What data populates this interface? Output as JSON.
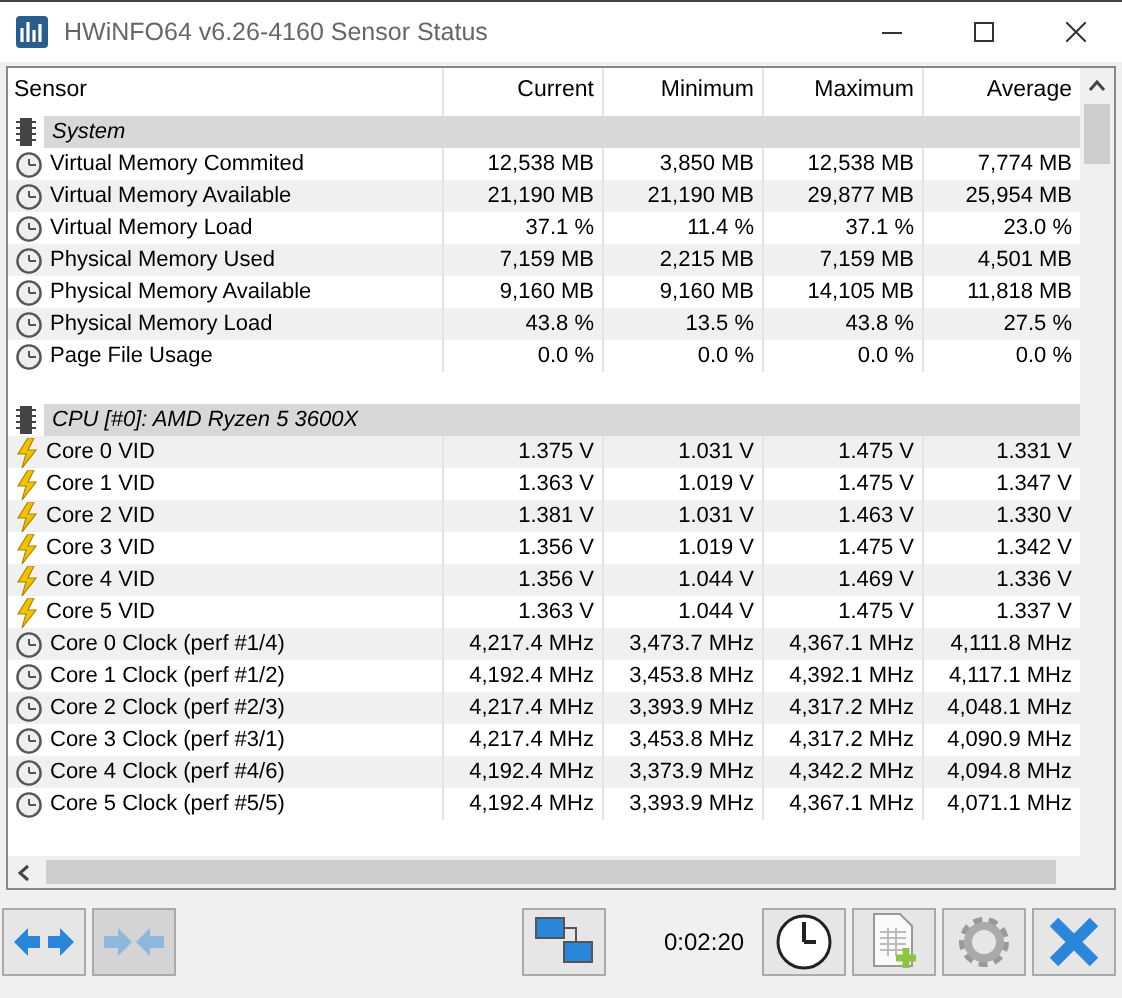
{
  "window": {
    "title": "HWiNFO64 v6.26-4160 Sensor Status"
  },
  "table": {
    "columns": [
      "Sensor",
      "Current",
      "Minimum",
      "Maximum",
      "Average"
    ],
    "rows": [
      {
        "kind": "group",
        "label": "System"
      },
      {
        "kind": "clock",
        "label": "Virtual Memory Commited",
        "values": [
          "12,538 MB",
          "3,850 MB",
          "12,538 MB",
          "7,774 MB"
        ]
      },
      {
        "kind": "clock",
        "label": "Virtual Memory Available",
        "values": [
          "21,190 MB",
          "21,190 MB",
          "29,877 MB",
          "25,954 MB"
        ]
      },
      {
        "kind": "clock",
        "label": "Virtual Memory Load",
        "values": [
          "37.1 %",
          "11.4 %",
          "37.1 %",
          "23.0 %"
        ]
      },
      {
        "kind": "clock",
        "label": "Physical Memory Used",
        "values": [
          "7,159 MB",
          "2,215 MB",
          "7,159 MB",
          "4,501 MB"
        ]
      },
      {
        "kind": "clock",
        "label": "Physical Memory Available",
        "values": [
          "9,160 MB",
          "9,160 MB",
          "14,105 MB",
          "11,818 MB"
        ]
      },
      {
        "kind": "clock",
        "label": "Physical Memory Load",
        "values": [
          "43.8 %",
          "13.5 %",
          "43.8 %",
          "27.5 %"
        ]
      },
      {
        "kind": "clock",
        "label": "Page File Usage",
        "values": [
          "0.0 %",
          "0.0 %",
          "0.0 %",
          "0.0 %"
        ]
      },
      {
        "kind": "blank"
      },
      {
        "kind": "group",
        "label": "CPU [#0]: AMD Ryzen 5 3600X"
      },
      {
        "kind": "bolt",
        "label": "Core 0 VID",
        "values": [
          "1.375 V",
          "1.031 V",
          "1.475 V",
          "1.331 V"
        ]
      },
      {
        "kind": "bolt",
        "label": "Core 1 VID",
        "values": [
          "1.363 V",
          "1.019 V",
          "1.475 V",
          "1.347 V"
        ]
      },
      {
        "kind": "bolt",
        "label": "Core 2 VID",
        "values": [
          "1.381 V",
          "1.031 V",
          "1.463 V",
          "1.330 V"
        ]
      },
      {
        "kind": "bolt",
        "label": "Core 3 VID",
        "values": [
          "1.356 V",
          "1.019 V",
          "1.475 V",
          "1.342 V"
        ]
      },
      {
        "kind": "bolt",
        "label": "Core 4 VID",
        "values": [
          "1.356 V",
          "1.044 V",
          "1.469 V",
          "1.336 V"
        ]
      },
      {
        "kind": "bolt",
        "label": "Core 5 VID",
        "values": [
          "1.363 V",
          "1.044 V",
          "1.475 V",
          "1.337 V"
        ]
      },
      {
        "kind": "clock",
        "label": "Core 0 Clock (perf #1/4)",
        "values": [
          "4,217.4 MHz",
          "3,473.7 MHz",
          "4,367.1 MHz",
          "4,111.8 MHz"
        ]
      },
      {
        "kind": "clock",
        "label": "Core 1 Clock (perf #1/2)",
        "values": [
          "4,192.4 MHz",
          "3,453.8 MHz",
          "4,392.1 MHz",
          "4,117.1 MHz"
        ]
      },
      {
        "kind": "clock",
        "label": "Core 2 Clock (perf #2/3)",
        "values": [
          "4,217.4 MHz",
          "3,393.9 MHz",
          "4,317.2 MHz",
          "4,048.1 MHz"
        ]
      },
      {
        "kind": "clock",
        "label": "Core 3 Clock (perf #3/1)",
        "values": [
          "4,217.4 MHz",
          "3,453.8 MHz",
          "4,317.2 MHz",
          "4,090.9 MHz"
        ]
      },
      {
        "kind": "clock",
        "label": "Core 4 Clock (perf #4/6)",
        "values": [
          "4,192.4 MHz",
          "3,373.9 MHz",
          "4,342.2 MHz",
          "4,094.8 MHz"
        ]
      },
      {
        "kind": "clock",
        "label": "Core 5 Clock (perf #5/5)",
        "values": [
          "4,192.4 MHz",
          "3,393.9 MHz",
          "4,367.1 MHz",
          "4,071.1 MHz"
        ]
      }
    ]
  },
  "toolbar": {
    "timer": "0:02:20",
    "buttons": [
      {
        "kind": "expand",
        "disabled": false
      },
      {
        "kind": "collapse",
        "disabled": true
      }
    ]
  }
}
